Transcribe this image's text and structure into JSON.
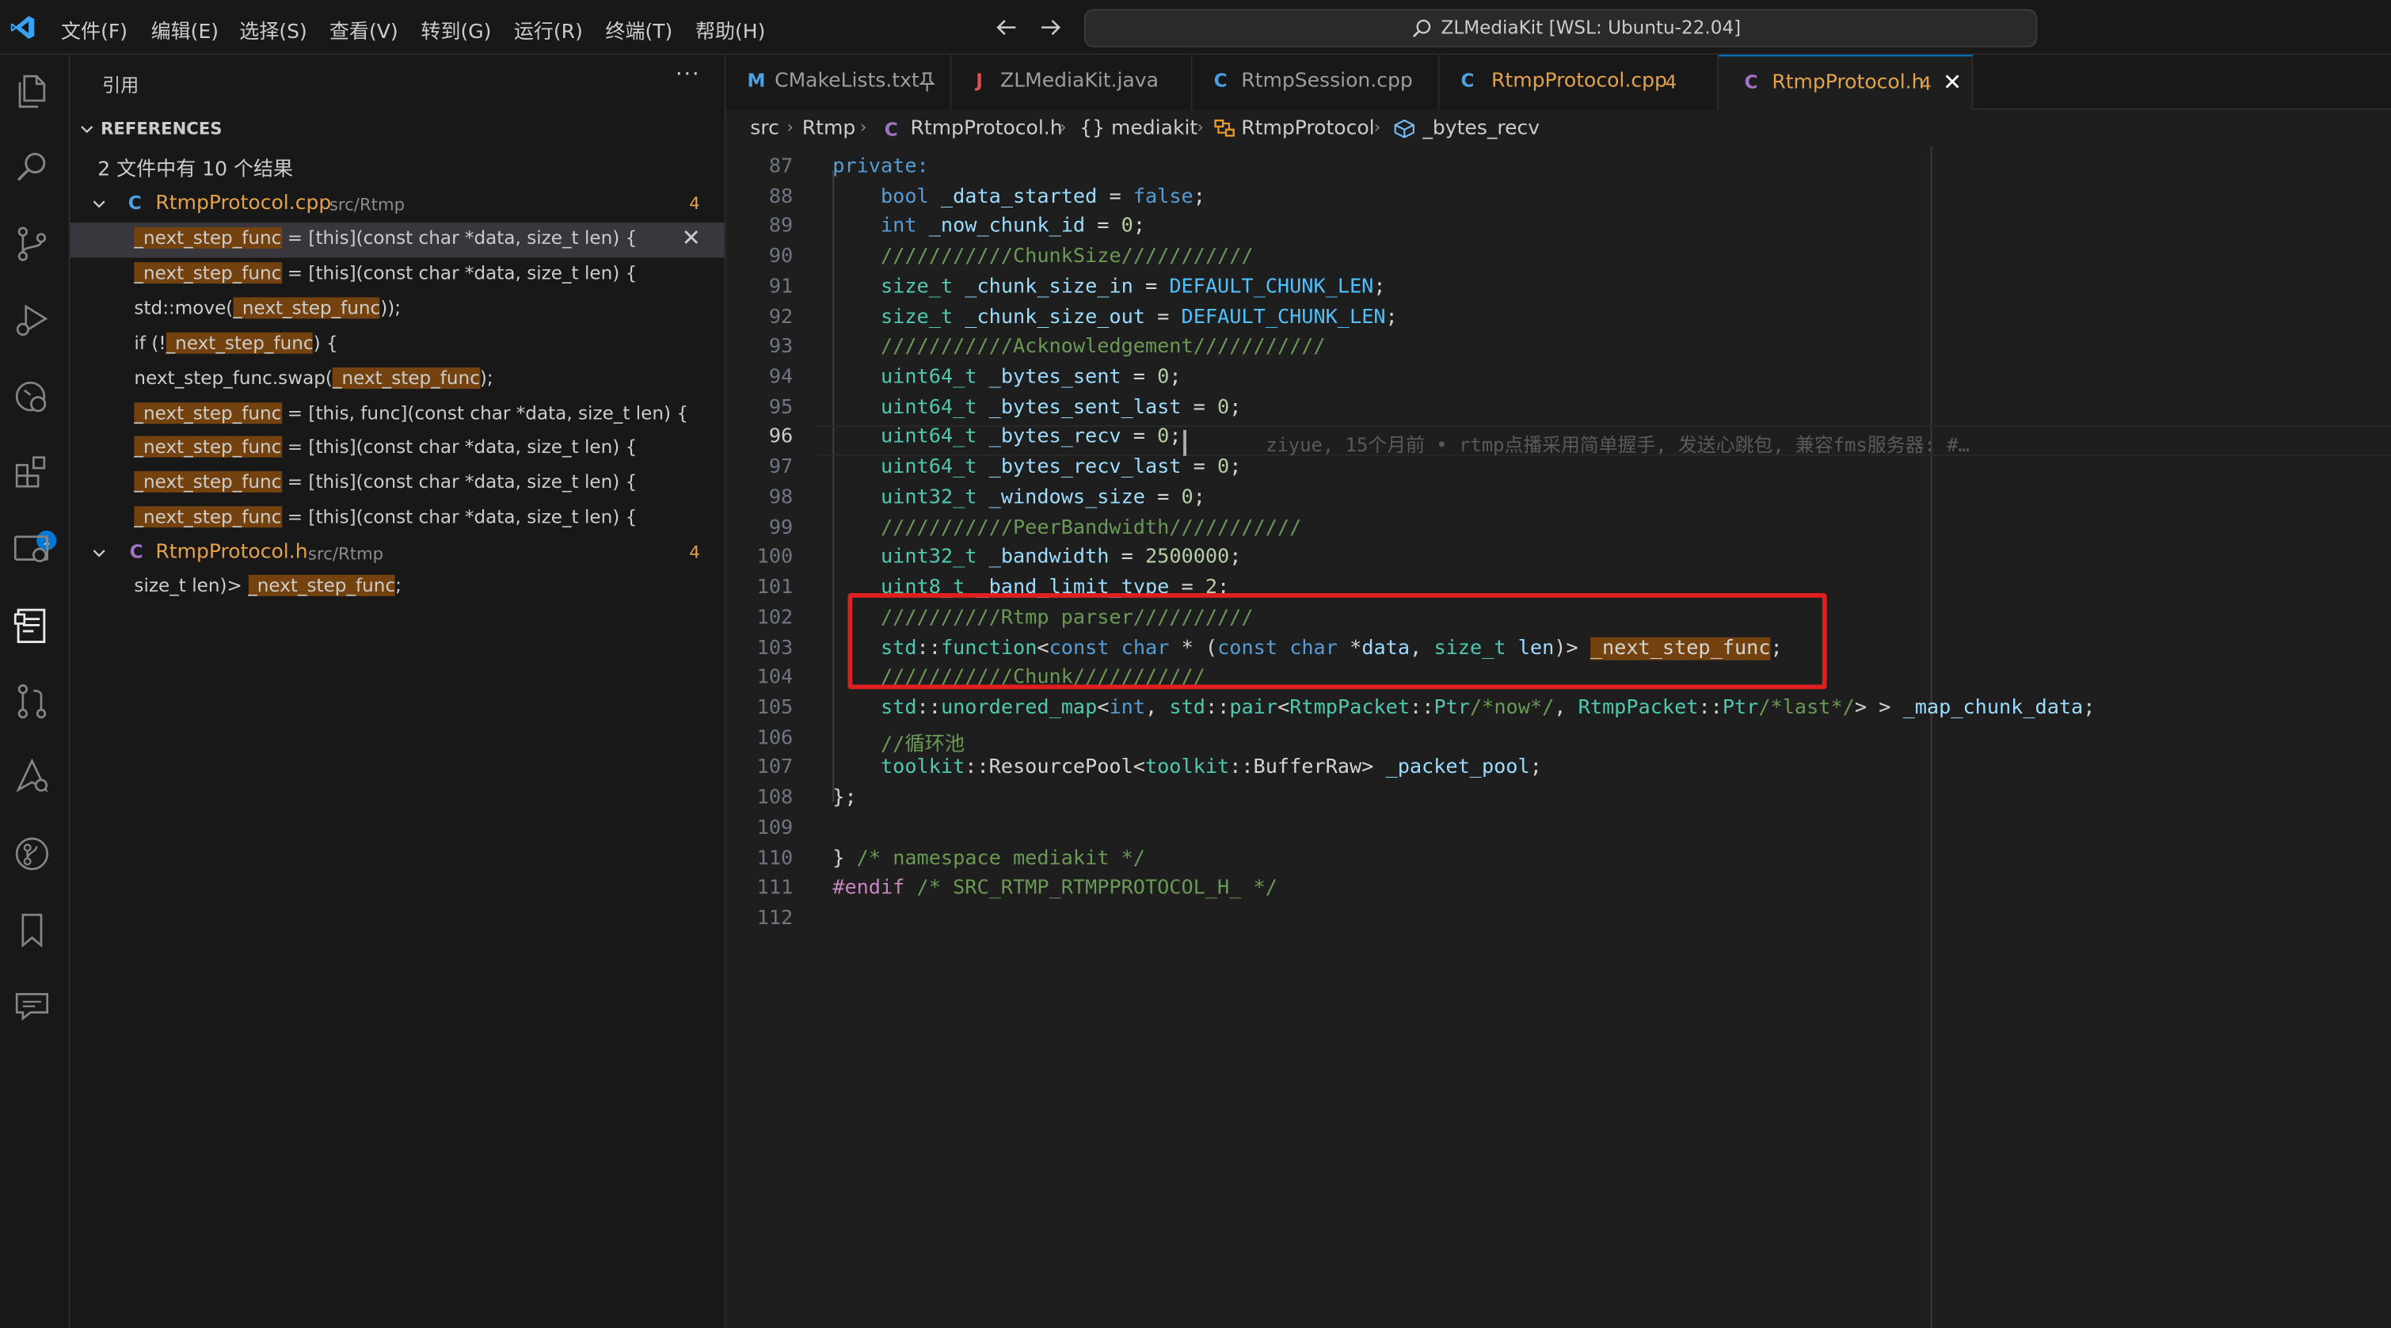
{
  "titlebar": {
    "menus": [
      "文件(F)",
      "编辑(E)",
      "选择(S)",
      "查看(V)",
      "转到(G)",
      "运行(R)",
      "终端(T)",
      "帮助(H)"
    ],
    "search": "ZLMediaKit [WSL: Ubuntu-22.04]"
  },
  "activitybar": {
    "icons": [
      "explorer-icon",
      "search-icon",
      "source-control-icon",
      "run-debug-icon",
      "remote-explorer-icon",
      "extensions-icon",
      "remote-window-icon",
      "references-icon",
      "pull-request-icon",
      "deploy-icon",
      "git-graph-icon",
      "bookmark-icon",
      "comments-icon"
    ],
    "extensions_badge": "1"
  },
  "sidebar": {
    "title": "引用",
    "more": "···",
    "section": "REFERENCES",
    "summary": "2 文件中有 10 个结果",
    "files": [
      {
        "icon": "C",
        "name": "RtmpProtocol.cpp",
        "path": "src/Rtmp",
        "count": "4",
        "items": [
          {
            "pre": "",
            "match": "_next_step_func",
            "post": " = [this](const char *data, size_t len) {"
          },
          {
            "pre": "",
            "match": "_next_step_func",
            "post": " = [this](const char *data, size_t len) {"
          },
          {
            "pre": "std::move(",
            "match": "_next_step_func",
            "post": "));"
          },
          {
            "pre": "if (!",
            "match": "_next_step_func",
            "post": ") {"
          },
          {
            "pre": "next_step_func.swap(",
            "match": "_next_step_func",
            "post": ");"
          },
          {
            "pre": "",
            "match": "_next_step_func",
            "post": " = [this, func](const char *data, size_t len) {"
          },
          {
            "pre": "",
            "match": "_next_step_func",
            "post": " = [this](const char *data, size_t len) {"
          },
          {
            "pre": "",
            "match": "_next_step_func",
            "post": " = [this](const char *data, size_t len) {"
          },
          {
            "pre": "",
            "match": "_next_step_func",
            "post": " = [this](const char *data, size_t len) {"
          }
        ]
      },
      {
        "icon": "C",
        "name": "RtmpProtocol.h",
        "path": "src/Rtmp",
        "count": "4",
        "items": [
          {
            "pre": "size_t len)> ",
            "match": "_next_step_func",
            "post": ";"
          }
        ]
      }
    ]
  },
  "tabs": [
    {
      "icon": "M",
      "label": "CMakeLists.txt",
      "badge": "",
      "pinned": true
    },
    {
      "icon": "J",
      "label": "ZLMediaKit.java",
      "badge": ""
    },
    {
      "icon": "C",
      "label": "RtmpSession.cpp",
      "badge": ""
    },
    {
      "icon": "C",
      "label": "RtmpProtocol.cpp",
      "badge": "4"
    },
    {
      "icon": "C",
      "label": "RtmpProtocol.h",
      "badge": "4",
      "close": "✕"
    }
  ],
  "breadcrumb": [
    "src",
    "Rtmp",
    "RtmpProtocol.h",
    "{} mediakit",
    "RtmpProtocol",
    "_bytes_recv"
  ],
  "editor": {
    "current_line": 96,
    "blame": "ziyue, 15个月前 • rtmp点播采用简单握手, 发送心跳包, 兼容fms服务器: #…",
    "lines": [
      {
        "n": 87,
        "tokens": [
          [
            "kw",
            "private:"
          ]
        ]
      },
      {
        "n": 88,
        "tokens": [
          [
            "",
            "    "
          ],
          [
            "kw",
            "bool"
          ],
          [
            "var",
            " _data_started"
          ],
          [
            "",
            " = "
          ],
          [
            "kw",
            "false"
          ],
          [
            "",
            ";"
          ]
        ]
      },
      {
        "n": 89,
        "tokens": [
          [
            "",
            "    "
          ],
          [
            "kw",
            "int"
          ],
          [
            "var",
            " _now_chunk_id"
          ],
          [
            "",
            " = "
          ],
          [
            "nm",
            "0"
          ],
          [
            "",
            ";"
          ]
        ]
      },
      {
        "n": 90,
        "tokens": [
          [
            "",
            "    "
          ],
          [
            "cm",
            "///////////ChunkSize///////////"
          ]
        ]
      },
      {
        "n": 91,
        "tokens": [
          [
            "",
            "    "
          ],
          [
            "ty",
            "size_t"
          ],
          [
            "var",
            " _chunk_size_in"
          ],
          [
            "",
            " = "
          ],
          [
            "mac",
            "DEFAULT_CHUNK_LEN"
          ],
          [
            "",
            ";"
          ]
        ]
      },
      {
        "n": 92,
        "tokens": [
          [
            "",
            "    "
          ],
          [
            "ty",
            "size_t"
          ],
          [
            "var",
            " _chunk_size_out"
          ],
          [
            "",
            " = "
          ],
          [
            "mac",
            "DEFAULT_CHUNK_LEN"
          ],
          [
            "",
            ";"
          ]
        ]
      },
      {
        "n": 93,
        "tokens": [
          [
            "",
            "    "
          ],
          [
            "cm",
            "///////////Acknowledgement///////////"
          ]
        ]
      },
      {
        "n": 94,
        "tokens": [
          [
            "",
            "    "
          ],
          [
            "ty",
            "uint64_t"
          ],
          [
            "var",
            " _bytes_sent"
          ],
          [
            "",
            " = "
          ],
          [
            "nm",
            "0"
          ],
          [
            "",
            ";"
          ]
        ]
      },
      {
        "n": 95,
        "tokens": [
          [
            "",
            "    "
          ],
          [
            "ty",
            "uint64_t"
          ],
          [
            "var",
            " _bytes_sent_last"
          ],
          [
            "",
            " = "
          ],
          [
            "nm",
            "0"
          ],
          [
            "",
            ";"
          ]
        ]
      },
      {
        "n": 96,
        "tokens": [
          [
            "",
            "    "
          ],
          [
            "ty",
            "uint64_t"
          ],
          [
            "var",
            " _bytes_recv"
          ],
          [
            "",
            " = "
          ],
          [
            "nm",
            "0"
          ],
          [
            "",
            ";"
          ]
        ]
      },
      {
        "n": 97,
        "tokens": [
          [
            "",
            "    "
          ],
          [
            "ty",
            "uint64_t"
          ],
          [
            "var",
            " _bytes_recv_last"
          ],
          [
            "",
            " = "
          ],
          [
            "nm",
            "0"
          ],
          [
            "",
            ";"
          ]
        ]
      },
      {
        "n": 98,
        "tokens": [
          [
            "",
            "    "
          ],
          [
            "ty",
            "uint32_t"
          ],
          [
            "var",
            " _windows_size"
          ],
          [
            "",
            " = "
          ],
          [
            "nm",
            "0"
          ],
          [
            "",
            ";"
          ]
        ]
      },
      {
        "n": 99,
        "tokens": [
          [
            "",
            "    "
          ],
          [
            "cm",
            "///////////PeerBandwidth///////////"
          ]
        ]
      },
      {
        "n": 100,
        "tokens": [
          [
            "",
            "    "
          ],
          [
            "ty",
            "uint32_t"
          ],
          [
            "var",
            " _bandwidth"
          ],
          [
            "",
            " = "
          ],
          [
            "nm",
            "2500000"
          ],
          [
            "",
            ";"
          ]
        ]
      },
      {
        "n": 101,
        "tokens": [
          [
            "",
            "    "
          ],
          [
            "ty",
            "uint8_t"
          ],
          [
            "var",
            " _band_limit_type"
          ],
          [
            "",
            " = "
          ],
          [
            "nm",
            "2"
          ],
          [
            "",
            ";"
          ]
        ]
      },
      {
        "n": 102,
        "tokens": [
          [
            "",
            "    "
          ],
          [
            "cm",
            "//////////Rtmp parser//////////"
          ]
        ]
      },
      {
        "n": 103,
        "tokens": [
          [
            "",
            "    "
          ],
          [
            "ty",
            "std"
          ],
          [
            "",
            "::"
          ],
          [
            "ty",
            "function"
          ],
          [
            "",
            "<"
          ],
          [
            "kw",
            "const char"
          ],
          [
            "",
            " * ("
          ],
          [
            "kw",
            "const char"
          ],
          [
            "",
            " *"
          ],
          [
            "var",
            "data"
          ],
          [
            "",
            ", "
          ],
          [
            "ty",
            "size_t"
          ],
          [
            "var",
            " len"
          ],
          [
            "",
            ")> "
          ],
          [
            "hl",
            "_next_step_func"
          ],
          [
            "",
            ";"
          ]
        ]
      },
      {
        "n": 104,
        "tokens": [
          [
            "",
            "    "
          ],
          [
            "cm",
            "///////////Chunk///////////"
          ]
        ]
      },
      {
        "n": 105,
        "tokens": [
          [
            "",
            "    "
          ],
          [
            "ty",
            "std"
          ],
          [
            "",
            "::"
          ],
          [
            "ty",
            "unordered_map"
          ],
          [
            "",
            "<"
          ],
          [
            "kw",
            "int"
          ],
          [
            "",
            ", "
          ],
          [
            "ty",
            "std"
          ],
          [
            "",
            "::"
          ],
          [
            "ty",
            "pair"
          ],
          [
            "",
            "<"
          ],
          [
            "ty",
            "RtmpPacket"
          ],
          [
            "",
            "::"
          ],
          [
            "ty",
            "Ptr"
          ],
          [
            "cm",
            "/*now*/"
          ],
          [
            "",
            ", "
          ],
          [
            "ty",
            "RtmpPacket"
          ],
          [
            "",
            "::"
          ],
          [
            "ty",
            "Ptr"
          ],
          [
            "cm",
            "/*last*/"
          ],
          [
            "",
            "> > "
          ],
          [
            "var",
            "_map_chunk_data"
          ],
          [
            "",
            ";"
          ]
        ]
      },
      {
        "n": 106,
        "tokens": [
          [
            "",
            "    "
          ],
          [
            "cm",
            "//循环池"
          ]
        ]
      },
      {
        "n": 107,
        "tokens": [
          [
            "",
            "    "
          ],
          [
            "ty",
            "toolkit"
          ],
          [
            "",
            "::ResourcePool<"
          ],
          [
            "ty",
            "toolkit"
          ],
          [
            "",
            "::BufferRaw> "
          ],
          [
            "var",
            "_packet_pool"
          ],
          [
            "",
            ";"
          ]
        ]
      },
      {
        "n": 108,
        "tokens": [
          [
            "",
            "};"
          ]
        ]
      },
      {
        "n": 109,
        "tokens": []
      },
      {
        "n": 110,
        "tokens": [
          [
            "",
            "} "
          ],
          [
            "cm",
            "/* namespace mediakit */"
          ]
        ]
      },
      {
        "n": 111,
        "tokens": [
          [
            "pp",
            "#endif"
          ],
          [
            "",
            " "
          ],
          [
            "cm",
            "/* SRC_RTMP_RTMPPROTOCOL_H_ */"
          ]
        ]
      },
      {
        "n": 112,
        "tokens": []
      }
    ]
  },
  "colors": {
    "accent": "#0078d4",
    "match_highlight": "#74420e",
    "annotation_box": "#e02020",
    "tab_modified": "#e2a24a"
  }
}
